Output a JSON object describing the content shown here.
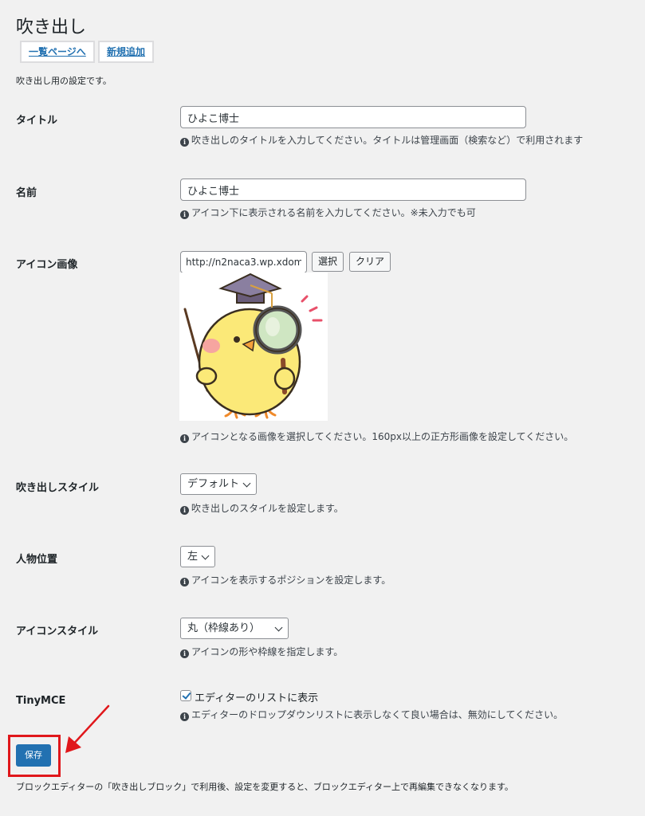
{
  "page": {
    "title": "吹き出し",
    "intro": "吹き出し用の設定です。"
  },
  "nav": {
    "list_label": "一覧ページへ",
    "add_label": "新規追加"
  },
  "form": {
    "title_row": {
      "label": "タイトル",
      "value": "ひよこ博士",
      "desc": "吹き出しのタイトルを入力してください。タイトルは管理画面（検索など）で利用されます"
    },
    "name_row": {
      "label": "名前",
      "value": "ひよこ博士",
      "desc": "アイコン下に表示される名前を入力してください。※未入力でも可"
    },
    "icon_row": {
      "label": "アイコン画像",
      "url_value": "http://n2naca3.wp.xdom",
      "select_label": "選択",
      "clear_label": "クリア",
      "desc": "アイコンとなる画像を選択してください。160px以上の正方形画像を設定してください。"
    },
    "style_row": {
      "label": "吹き出しスタイル",
      "selected": "デフォルト",
      "desc": "吹き出しのスタイルを設定します。"
    },
    "position_row": {
      "label": "人物位置",
      "selected": "左",
      "desc": "アイコンを表示するポジションを設定します。"
    },
    "icon_style_row": {
      "label": "アイコンスタイル",
      "selected": "丸（枠線あり）",
      "desc": "アイコンの形や枠線を指定します。"
    },
    "tinymce_row": {
      "label": "TinyMCE",
      "checkbox_label": "エディターのリストに表示",
      "checked": true,
      "desc": "エディターのドロップダウンリストに表示しなくて良い場合は、無効にしてください。"
    }
  },
  "actions": {
    "save_label": "保存"
  },
  "footer": {
    "note": "ブロックエディターの「吹き出しブロック」で利用後、設定を変更すると、ブロックエディター上で再編集できなくなります。"
  },
  "colors": {
    "primary": "#2271b1",
    "highlight": "#e0171b"
  }
}
